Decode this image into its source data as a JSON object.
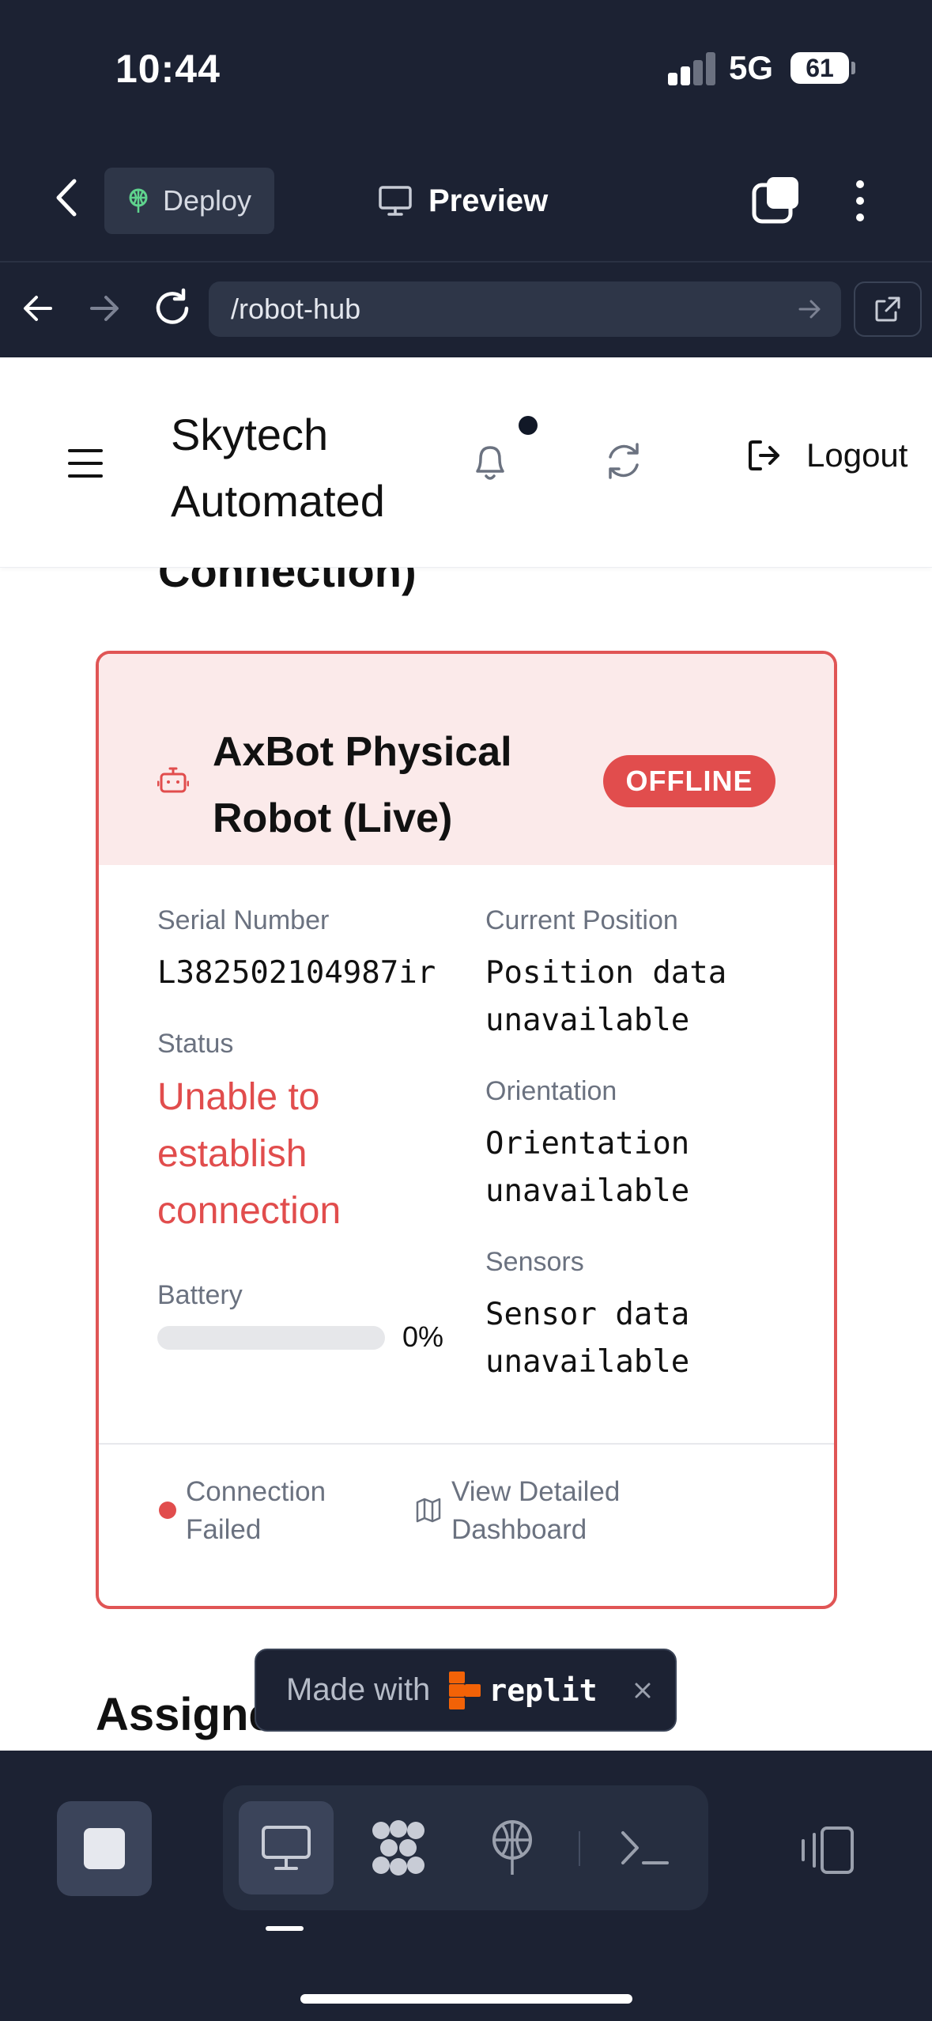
{
  "status_bar": {
    "time": "10:44",
    "network": "5G",
    "battery": "61"
  },
  "browser_top": {
    "deploy_label": "Deploy",
    "preview_label": "Preview"
  },
  "url_bar": {
    "url": "/robot-hub"
  },
  "app_header": {
    "brand": "Skytech Automated",
    "logout_label": "Logout"
  },
  "content": {
    "cut_heading": "Connection)",
    "assigned_heading": "Assigned Robots"
  },
  "robot_card": {
    "name": "AxBot Physical Robot (Live)",
    "status_badge": "OFFLINE",
    "serial_label": "Serial Number",
    "serial_value": "L382502104987ir",
    "status_label": "Status",
    "status_value": "Unable to establish connection",
    "battery_label": "Battery",
    "battery_percent_text": "0%",
    "battery_level": 0,
    "position_label": "Current Position",
    "position_value": "Position data unavailable",
    "orientation_label": "Orientation",
    "orientation_value": "Orientation unavailable",
    "sensors_label": "Sensors",
    "sensors_value": "Sensor data unavailable",
    "connection_status": "Connection Failed",
    "dashboard_link": "View Detailed Dashboard"
  },
  "made_with": {
    "text": "Made with",
    "brand": "replit"
  },
  "colors": {
    "chrome": "#1c2233",
    "danger": "#e14d4d",
    "danger_bg": "#fbeaea"
  },
  "icons": [
    "chevron-left-icon",
    "deploy-icon",
    "monitor-icon",
    "tabs-icon",
    "more-vertical-icon",
    "arrow-left-icon",
    "arrow-right-icon",
    "reload-icon",
    "external-link-icon",
    "menu-icon",
    "bell-icon",
    "refresh-icon",
    "logout-icon",
    "robot-icon",
    "map-icon",
    "close-icon",
    "stop-icon",
    "preview-tool-icon",
    "extensions-icon",
    "deploy-tool-icon",
    "terminal-icon",
    "devices-icon"
  ]
}
